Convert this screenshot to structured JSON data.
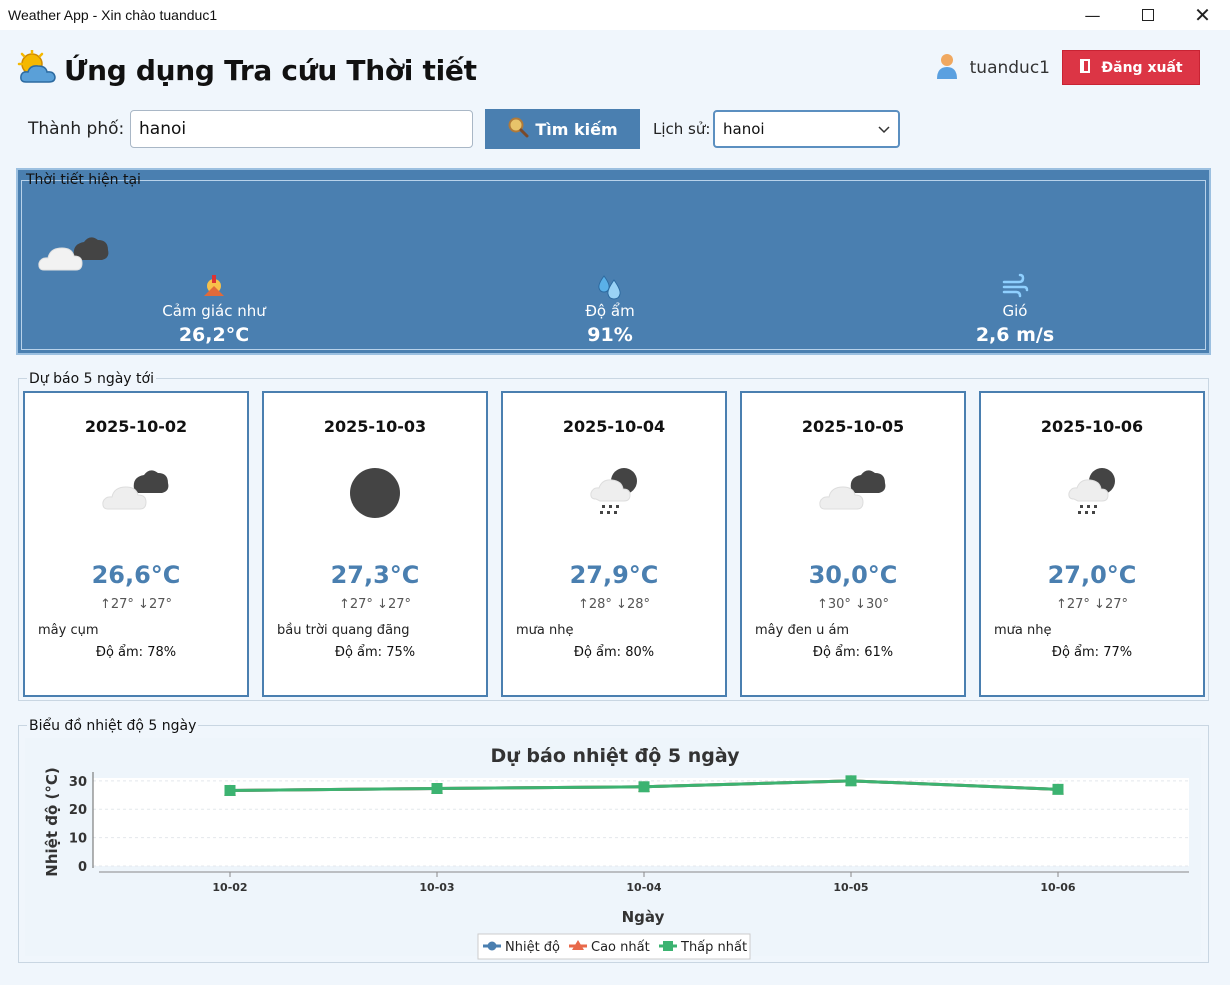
{
  "window": {
    "title": "Weather App - Xin chào tuanduc1"
  },
  "header": {
    "title": "Ứng dụng Tra cứu Thời tiết",
    "username": "tuanduc1",
    "logout_label": "Đăng xuất"
  },
  "search": {
    "city_label": "Thành phố:",
    "city_value": "hanoi",
    "button_label": "Tìm kiếm",
    "history_label": "Lịch sử:",
    "history_value": "hanoi"
  },
  "current": {
    "legend": "Thời tiết hiện tại",
    "feels_like_label": "Cảm giác như",
    "feels_like_value": "26,2°C",
    "humidity_label": "Độ ẩm",
    "humidity_value": "91%",
    "wind_label": "Gió",
    "wind_value": "2,6 m/s"
  },
  "forecast": {
    "legend": "Dự báo 5 ngày tới",
    "days": [
      {
        "date": "2025-10-02",
        "icon": "broken-clouds-icon",
        "temp": "26,6°C",
        "hilo": "↑27° ↓27°",
        "desc": "mây cụm",
        "humidity": "Độ ẩm: 78%"
      },
      {
        "date": "2025-10-03",
        "icon": "clear-night-icon",
        "temp": "27,3°C",
        "hilo": "↑27° ↓27°",
        "desc": "bầu trời quang đãng",
        "humidity": "Độ ẩm: 75%"
      },
      {
        "date": "2025-10-04",
        "icon": "rain-night-icon",
        "temp": "27,9°C",
        "hilo": "↑28° ↓28°",
        "desc": "mưa nhẹ",
        "humidity": "Độ ẩm: 80%"
      },
      {
        "date": "2025-10-05",
        "icon": "broken-clouds-icon",
        "temp": "30,0°C",
        "hilo": "↑30° ↓30°",
        "desc": "mây đen u ám",
        "humidity": "Độ ẩm: 61%"
      },
      {
        "date": "2025-10-06",
        "icon": "rain-night-icon",
        "temp": "27,0°C",
        "hilo": "↑27° ↓27°",
        "desc": "mưa nhẹ",
        "humidity": "Độ ẩm: 77%"
      }
    ]
  },
  "chart_section": {
    "legend": "Biểu đồ nhiệt độ 5 ngày"
  },
  "colors": {
    "accent": "#4a7fb0",
    "logout": "#dc3545",
    "series_temp": "#4a7fb0",
    "series_max": "#e8694a",
    "series_min": "#3cb371"
  },
  "chart_data": {
    "type": "line",
    "title": "Dự báo nhiệt độ 5 ngày",
    "xlabel": "Ngày",
    "ylabel": "Nhiệt độ (°C)",
    "categories": [
      "10-02",
      "10-03",
      "10-04",
      "10-05",
      "10-06"
    ],
    "yticks": [
      0,
      10,
      20,
      30
    ],
    "ylim": [
      0,
      31
    ],
    "legend_position": "bottom",
    "series": [
      {
        "name": "Nhiệt độ",
        "values": [
          26.6,
          27.3,
          27.9,
          30.0,
          27.0
        ],
        "color": "#4a7fb0",
        "marker": "circle"
      },
      {
        "name": "Cao nhất",
        "values": [
          26.6,
          27.3,
          27.9,
          30.0,
          27.0
        ],
        "color": "#e8694a",
        "marker": "triangle"
      },
      {
        "name": "Thấp nhất",
        "values": [
          26.6,
          27.3,
          27.9,
          30.0,
          27.0
        ],
        "color": "#3cb371",
        "marker": "square"
      }
    ]
  }
}
